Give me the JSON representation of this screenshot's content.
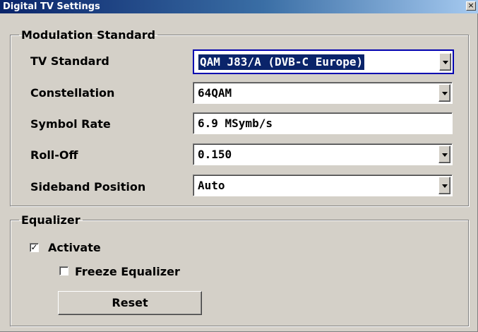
{
  "window": {
    "title": "Digital TV Settings",
    "close_glyph": "×"
  },
  "modulation": {
    "legend": "Modulation Standard",
    "tv_standard": {
      "label": "TV Standard",
      "value": "QAM J83/A (DVB-C Europe)"
    },
    "constellation": {
      "label": "Constellation",
      "value": "64QAM"
    },
    "symbol_rate": {
      "label": "Symbol Rate",
      "value": "6.9 MSymb/s"
    },
    "roll_off": {
      "label": "Roll-Off",
      "value": "0.150"
    },
    "sideband": {
      "label": "Sideband Position",
      "value": "Auto"
    }
  },
  "equalizer": {
    "legend": "Equalizer",
    "activate": {
      "label": "Activate",
      "checked": true,
      "mark": "✓"
    },
    "freeze": {
      "label": "Freeze Equalizer",
      "checked": false
    },
    "reset_label": "Reset"
  },
  "colors": {
    "dialog_bg": "#d4d0c8",
    "title_bg": "#0a246a",
    "focus_border": "#0000b0",
    "selection_bg": "#0a246a"
  },
  "icons": [
    "close-icon",
    "dropdown-arrow-icon",
    "checkmark-icon"
  ]
}
